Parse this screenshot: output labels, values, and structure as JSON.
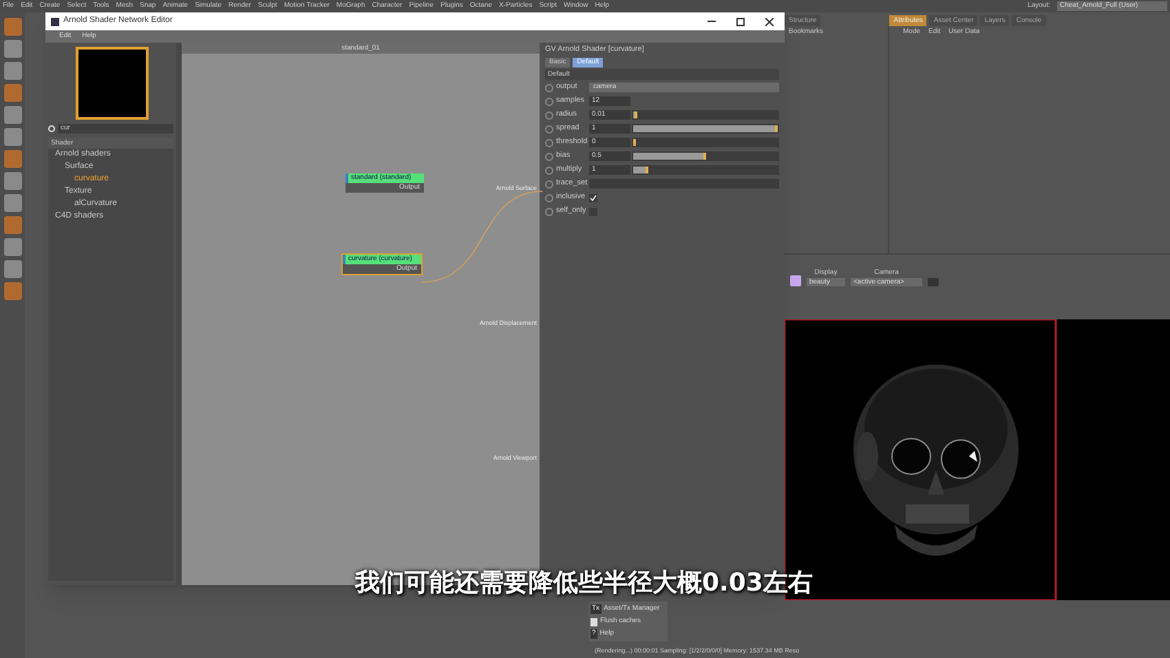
{
  "menu_bar": {
    "items": [
      "File",
      "Edit",
      "Create",
      "Select",
      "Tools",
      "Mesh",
      "Snap",
      "Animate",
      "Simulate",
      "Render",
      "Sculpt",
      "Motion Tracker",
      "MoGraph",
      "Character",
      "Pipeline",
      "Plugins",
      "Octane",
      "X-Particles",
      "Script",
      "Window",
      "Help"
    ],
    "layout_label": "Layout:",
    "layout_value": "Cheat_Arnold_Full (User)"
  },
  "editor": {
    "title": "Arnold Shader Network Editor",
    "menu": [
      "Edit",
      "Help"
    ],
    "search": {
      "value": "cur"
    },
    "tree_header": "Shader",
    "tree": [
      {
        "label": "Arnold shaders",
        "selected": false,
        "children": [
          {
            "label": "Surface",
            "selected": false,
            "children": [
              {
                "label": "curvature",
                "selected": true
              }
            ]
          },
          {
            "label": "Texture",
            "selected": false,
            "children": [
              {
                "label": "alCurvature",
                "selected": false
              }
            ]
          }
        ]
      },
      {
        "label": "C4D shaders",
        "selected": false
      }
    ],
    "canvas_title": "standard_01",
    "nodes": [
      {
        "title": "standard (standard)",
        "port": "Output",
        "selected": false
      },
      {
        "title": "curvature (curvature)",
        "port": "Output",
        "selected": true
      }
    ],
    "outputs": [
      "Arnold Surface",
      "Arnold Displacement",
      "Arnold Viewport"
    ],
    "attributes": {
      "title": "GV Arnold Shader [curvature]",
      "tabs": [
        {
          "label": "Basic",
          "selected": false
        },
        {
          "label": "Default",
          "selected": true
        }
      ],
      "section": "Default",
      "params": [
        {
          "kind": "dropdown",
          "name": "output",
          "value": "camera"
        },
        {
          "kind": "number",
          "name": "samples",
          "value": "12"
        },
        {
          "kind": "slider",
          "name": "radius",
          "value": "0.01",
          "level": 0.03
        },
        {
          "kind": "slider",
          "name": "spread",
          "value": "1",
          "level": 1
        },
        {
          "kind": "slider",
          "name": "threshold",
          "value": "0",
          "level": 0
        },
        {
          "kind": "slider",
          "name": "bias",
          "value": "0.5",
          "level": 0.5
        },
        {
          "kind": "slider",
          "name": "multiply",
          "value": "1",
          "level": 0.1
        },
        {
          "kind": "text",
          "name": "trace_set"
        },
        {
          "kind": "check",
          "name": "inclusive",
          "checked": true
        },
        {
          "kind": "check",
          "name": "self_only",
          "checked": false
        }
      ]
    }
  },
  "right_tabs": [
    {
      "label": "Structure",
      "selected": false
    },
    {
      "label": "Attributes",
      "selected": true
    },
    {
      "label": "Asset Center",
      "selected": false
    },
    {
      "label": "Layers",
      "selected": false
    },
    {
      "label": "Console",
      "selected": false
    }
  ],
  "object_toolbar": [
    "Bookmarks"
  ],
  "attributes_menu": [
    "Mode",
    "Edit",
    "User Data"
  ],
  "render_view": {
    "display_label": "Display",
    "display_value": "beauty",
    "camera_label": "Camera",
    "camera_value": "<active camera>",
    "status": "(Rendering...)  00:00:01  Sampling: [1/2/2/0/0/0]  Memory: 1537.34 MB  Reso"
  },
  "popup_menu": [
    {
      "kind": "glyph",
      "icon": "Tx",
      "label": "Asset/Tx Manager"
    },
    {
      "kind": "trash",
      "label": "Flush caches"
    },
    {
      "kind": "glyph",
      "icon": "?",
      "label": "Help"
    }
  ],
  "subtitle": "我们可能还需要降低些半径大概0.03左右"
}
